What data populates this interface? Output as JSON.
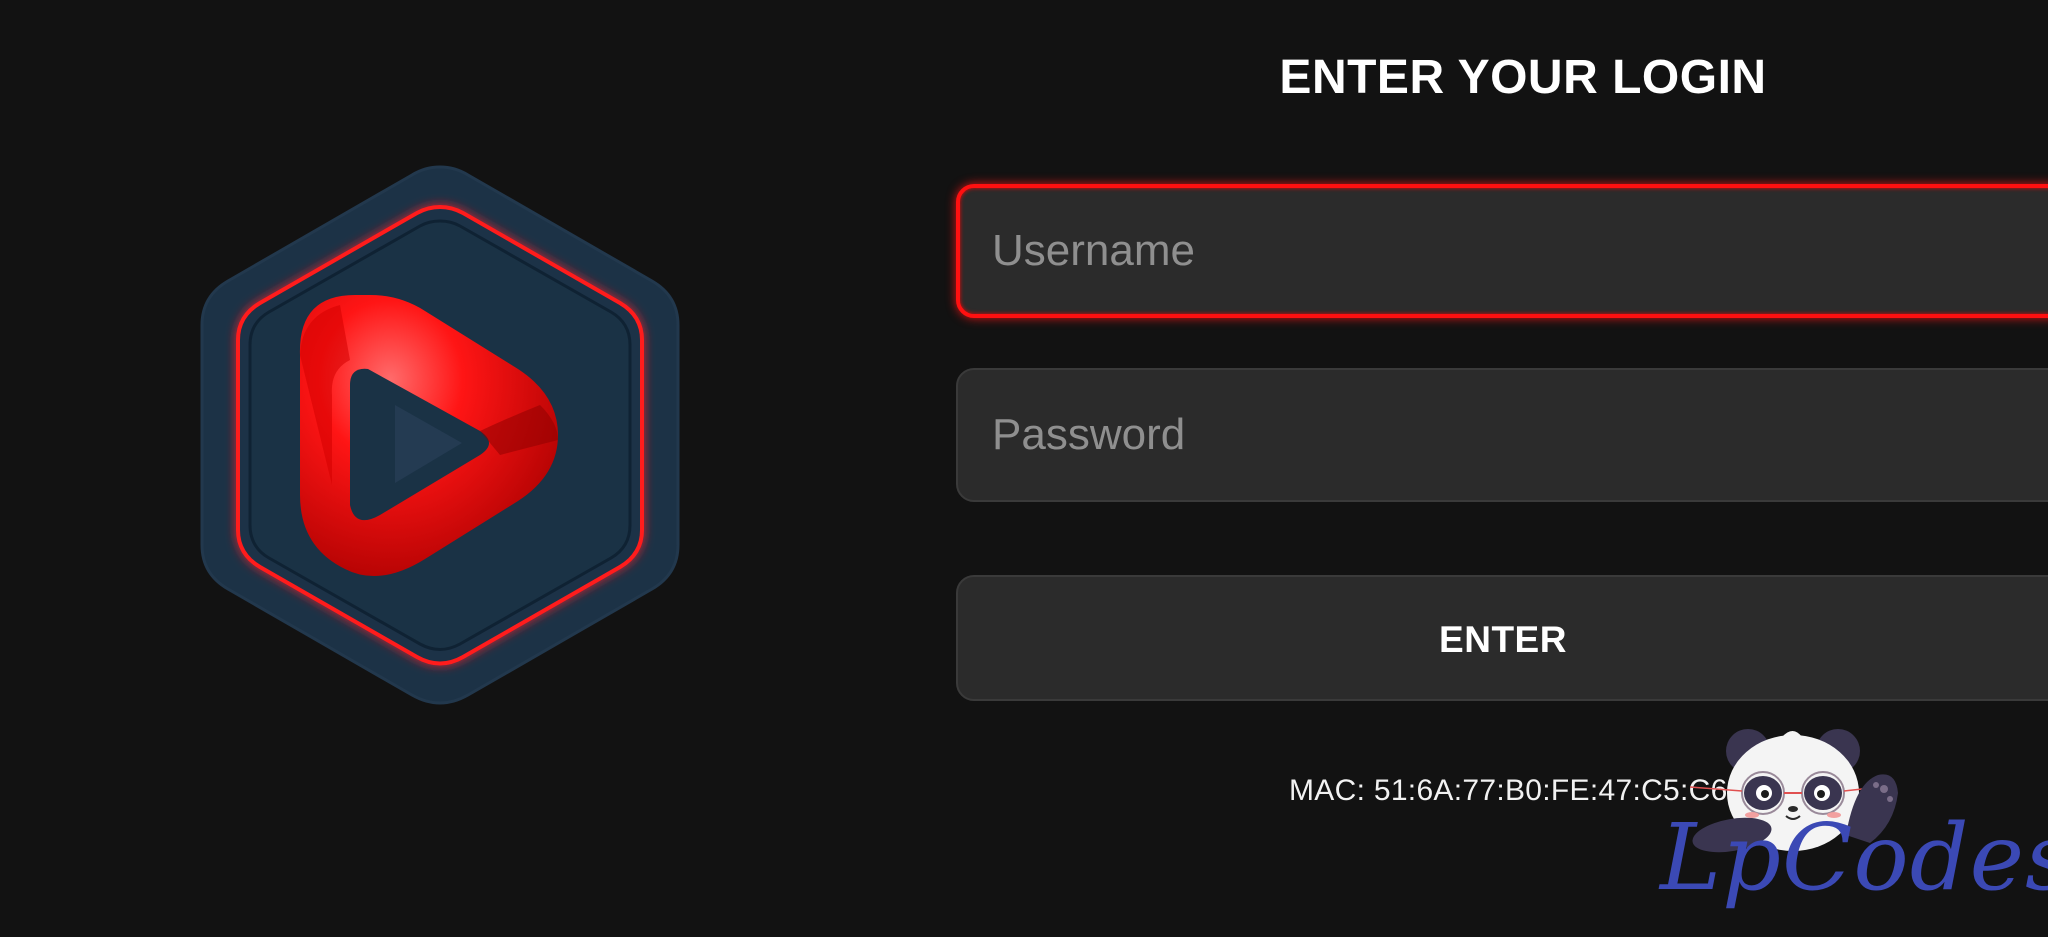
{
  "login": {
    "title": "ENTER YOUR LOGIN",
    "username_placeholder": "Username",
    "password_placeholder": "Password",
    "enter_label": "ENTER",
    "mac": "MAC: 51:6A:77:B0:FE:47:C5:C6"
  },
  "logo": {
    "icon": "play-hexagon-logo-icon",
    "accent": "#ff1a1a",
    "panel": "#1c3348"
  },
  "watermark": {
    "text": "LpCodes",
    "icon": "panda-mascot-icon",
    "color": "#3b49b5"
  },
  "colors": {
    "background": "#121212",
    "field": "#2b2b2b",
    "focus": "#ff1010",
    "text": "#ffffff",
    "placeholder": "#8f8f8f"
  }
}
